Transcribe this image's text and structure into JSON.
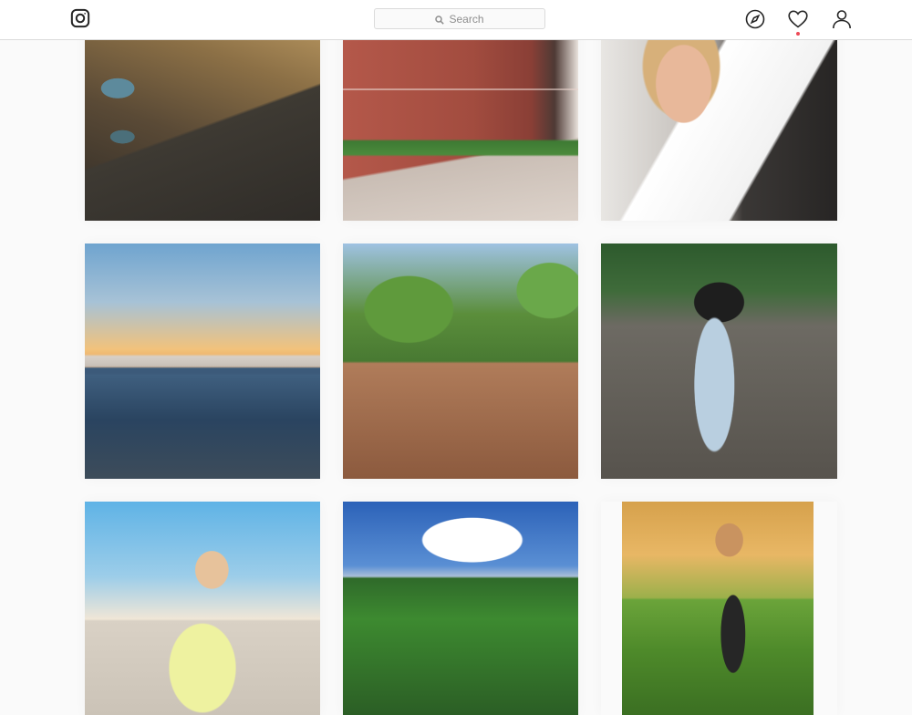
{
  "header": {
    "logo_icon": "instagram-icon",
    "search": {
      "placeholder": "Search",
      "icon": "search-icon"
    },
    "nav": [
      {
        "name": "explore",
        "icon": "compass-icon"
      },
      {
        "name": "activity",
        "icon": "heart-icon",
        "has_notification": true
      },
      {
        "name": "profile",
        "icon": "user-icon"
      }
    ]
  },
  "colors": {
    "background": "#fafafa",
    "header_border": "#dbdbdb",
    "notification": "#ed4956"
  },
  "feed": {
    "tiles": [
      {
        "subject": "mountain-lakes"
      },
      {
        "subject": "woman-red-brick-building"
      },
      {
        "subject": "woman-car-selfie"
      },
      {
        "subject": "harbor-sunset-boats"
      },
      {
        "subject": "green-hexagon-building"
      },
      {
        "subject": "woman-dry-grass"
      },
      {
        "subject": "woman-yellow-tshirt-ferris-wheel"
      },
      {
        "subject": "river-valley"
      },
      {
        "subject": "woman-sunset-meadow"
      }
    ]
  }
}
